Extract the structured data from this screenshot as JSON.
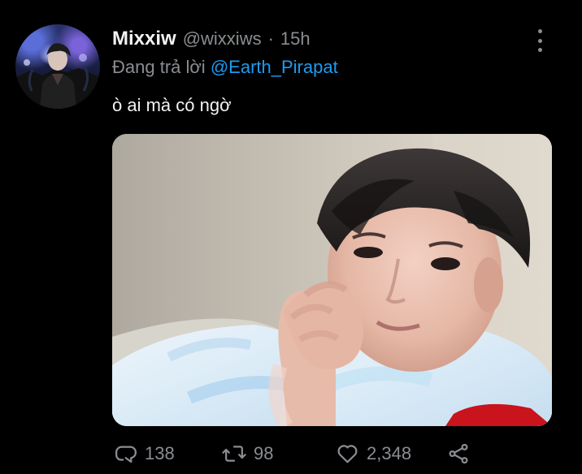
{
  "tweet": {
    "display_name": "Mixxiw",
    "handle": "@wixxiws",
    "separator": "·",
    "time": "15h",
    "reply_prefix": "Đang trả lời",
    "reply_to": "@Earth_Pirapat",
    "text": "ò ai mà có ngờ"
  },
  "actions": {
    "reply_count": "138",
    "retweet_count": "98",
    "like_count": "2,348"
  },
  "icons": {
    "more": "more-vertical-icon",
    "reply": "reply-icon",
    "retweet": "retweet-icon",
    "like": "heart-icon",
    "share": "share-icon"
  },
  "colors": {
    "background": "#000000",
    "primary_text": "#f2f2f2",
    "secondary_text": "#8a8d91",
    "link": "#1d9bf0"
  }
}
